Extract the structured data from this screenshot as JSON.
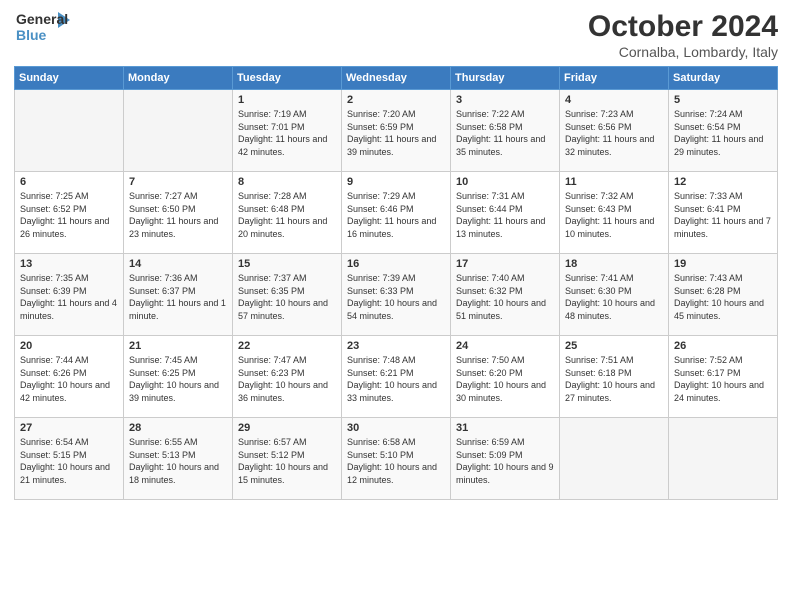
{
  "header": {
    "logo_line1": "General",
    "logo_line2": "Blue",
    "title": "October 2024",
    "subtitle": "Cornalba, Lombardy, Italy"
  },
  "calendar": {
    "days_of_week": [
      "Sunday",
      "Monday",
      "Tuesday",
      "Wednesday",
      "Thursday",
      "Friday",
      "Saturday"
    ],
    "weeks": [
      [
        {
          "day": "",
          "text": ""
        },
        {
          "day": "",
          "text": ""
        },
        {
          "day": "1",
          "text": "Sunrise: 7:19 AM\nSunset: 7:01 PM\nDaylight: 11 hours and 42 minutes."
        },
        {
          "day": "2",
          "text": "Sunrise: 7:20 AM\nSunset: 6:59 PM\nDaylight: 11 hours and 39 minutes."
        },
        {
          "day": "3",
          "text": "Sunrise: 7:22 AM\nSunset: 6:58 PM\nDaylight: 11 hours and 35 minutes."
        },
        {
          "day": "4",
          "text": "Sunrise: 7:23 AM\nSunset: 6:56 PM\nDaylight: 11 hours and 32 minutes."
        },
        {
          "day": "5",
          "text": "Sunrise: 7:24 AM\nSunset: 6:54 PM\nDaylight: 11 hours and 29 minutes."
        }
      ],
      [
        {
          "day": "6",
          "text": "Sunrise: 7:25 AM\nSunset: 6:52 PM\nDaylight: 11 hours and 26 minutes."
        },
        {
          "day": "7",
          "text": "Sunrise: 7:27 AM\nSunset: 6:50 PM\nDaylight: 11 hours and 23 minutes."
        },
        {
          "day": "8",
          "text": "Sunrise: 7:28 AM\nSunset: 6:48 PM\nDaylight: 11 hours and 20 minutes."
        },
        {
          "day": "9",
          "text": "Sunrise: 7:29 AM\nSunset: 6:46 PM\nDaylight: 11 hours and 16 minutes."
        },
        {
          "day": "10",
          "text": "Sunrise: 7:31 AM\nSunset: 6:44 PM\nDaylight: 11 hours and 13 minutes."
        },
        {
          "day": "11",
          "text": "Sunrise: 7:32 AM\nSunset: 6:43 PM\nDaylight: 11 hours and 10 minutes."
        },
        {
          "day": "12",
          "text": "Sunrise: 7:33 AM\nSunset: 6:41 PM\nDaylight: 11 hours and 7 minutes."
        }
      ],
      [
        {
          "day": "13",
          "text": "Sunrise: 7:35 AM\nSunset: 6:39 PM\nDaylight: 11 hours and 4 minutes."
        },
        {
          "day": "14",
          "text": "Sunrise: 7:36 AM\nSunset: 6:37 PM\nDaylight: 11 hours and 1 minute."
        },
        {
          "day": "15",
          "text": "Sunrise: 7:37 AM\nSunset: 6:35 PM\nDaylight: 10 hours and 57 minutes."
        },
        {
          "day": "16",
          "text": "Sunrise: 7:39 AM\nSunset: 6:33 PM\nDaylight: 10 hours and 54 minutes."
        },
        {
          "day": "17",
          "text": "Sunrise: 7:40 AM\nSunset: 6:32 PM\nDaylight: 10 hours and 51 minutes."
        },
        {
          "day": "18",
          "text": "Sunrise: 7:41 AM\nSunset: 6:30 PM\nDaylight: 10 hours and 48 minutes."
        },
        {
          "day": "19",
          "text": "Sunrise: 7:43 AM\nSunset: 6:28 PM\nDaylight: 10 hours and 45 minutes."
        }
      ],
      [
        {
          "day": "20",
          "text": "Sunrise: 7:44 AM\nSunset: 6:26 PM\nDaylight: 10 hours and 42 minutes."
        },
        {
          "day": "21",
          "text": "Sunrise: 7:45 AM\nSunset: 6:25 PM\nDaylight: 10 hours and 39 minutes."
        },
        {
          "day": "22",
          "text": "Sunrise: 7:47 AM\nSunset: 6:23 PM\nDaylight: 10 hours and 36 minutes."
        },
        {
          "day": "23",
          "text": "Sunrise: 7:48 AM\nSunset: 6:21 PM\nDaylight: 10 hours and 33 minutes."
        },
        {
          "day": "24",
          "text": "Sunrise: 7:50 AM\nSunset: 6:20 PM\nDaylight: 10 hours and 30 minutes."
        },
        {
          "day": "25",
          "text": "Sunrise: 7:51 AM\nSunset: 6:18 PM\nDaylight: 10 hours and 27 minutes."
        },
        {
          "day": "26",
          "text": "Sunrise: 7:52 AM\nSunset: 6:17 PM\nDaylight: 10 hours and 24 minutes."
        }
      ],
      [
        {
          "day": "27",
          "text": "Sunrise: 6:54 AM\nSunset: 5:15 PM\nDaylight: 10 hours and 21 minutes."
        },
        {
          "day": "28",
          "text": "Sunrise: 6:55 AM\nSunset: 5:13 PM\nDaylight: 10 hours and 18 minutes."
        },
        {
          "day": "29",
          "text": "Sunrise: 6:57 AM\nSunset: 5:12 PM\nDaylight: 10 hours and 15 minutes."
        },
        {
          "day": "30",
          "text": "Sunrise: 6:58 AM\nSunset: 5:10 PM\nDaylight: 10 hours and 12 minutes."
        },
        {
          "day": "31",
          "text": "Sunrise: 6:59 AM\nSunset: 5:09 PM\nDaylight: 10 hours and 9 minutes."
        },
        {
          "day": "",
          "text": ""
        },
        {
          "day": "",
          "text": ""
        }
      ]
    ]
  }
}
